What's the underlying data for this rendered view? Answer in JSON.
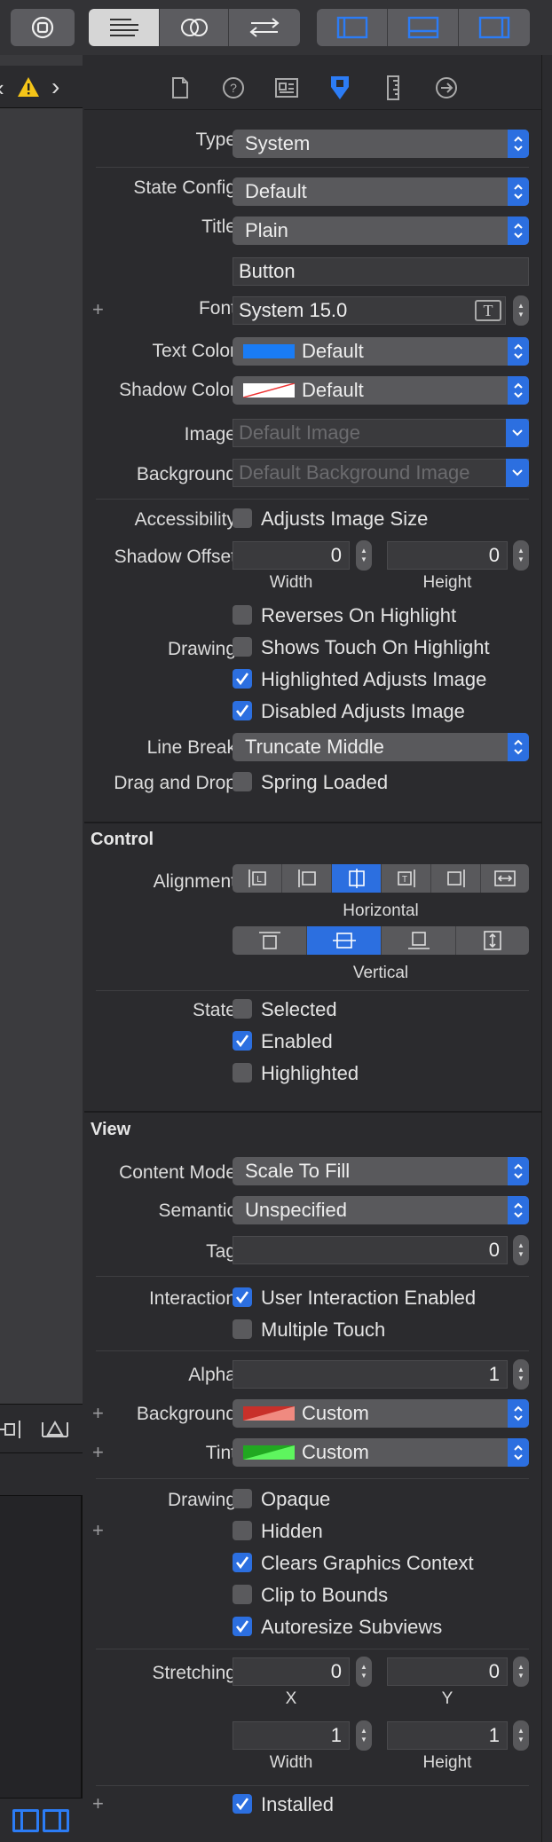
{
  "toolbar": {
    "left_icon": "stop-icon",
    "editor_modes": [
      "standard-editor-icon",
      "assistant-editor-icon",
      "version-editor-icon"
    ],
    "panel_toggles": [
      "navigator-panel-icon",
      "debug-panel-icon",
      "utilities-panel-icon"
    ]
  },
  "inspector_tabs": [
    "file-inspector-icon",
    "quick-help-icon",
    "identity-inspector-icon",
    "attributes-inspector-icon",
    "size-inspector-icon",
    "connections-inspector-icon"
  ],
  "button_section": {
    "type_label": "Type",
    "type_value": "System",
    "state_config_label": "State Config",
    "state_config_value": "Default",
    "title_label": "Title",
    "title_value": "Plain",
    "title_text": "Button",
    "font_label": "Font",
    "font_value": "System 15.0",
    "text_color_label": "Text Color",
    "text_color_value": "Default",
    "shadow_color_label": "Shadow Color",
    "shadow_color_value": "Default",
    "image_label": "Image",
    "image_placeholder": "Default Image",
    "background_label": "Background",
    "background_placeholder": "Default Background Image",
    "accessibility_label": "Accessibility",
    "adjusts_image_size": "Adjusts Image Size",
    "shadow_offset_label": "Shadow Offset",
    "shadow_width": "0",
    "shadow_height": "0",
    "width_label": "Width",
    "height_label": "Height",
    "drawing_label": "Drawing",
    "reverses_on_highlight": "Reverses On Highlight",
    "shows_touch_on_highlight": "Shows Touch On Highlight",
    "highlighted_adjusts_image": "Highlighted Adjusts Image",
    "disabled_adjusts_image": "Disabled Adjusts Image",
    "line_break_label": "Line Break",
    "line_break_value": "Truncate Middle",
    "drag_drop_label": "Drag and Drop",
    "spring_loaded": "Spring Loaded"
  },
  "control_section": {
    "title": "Control",
    "alignment_label": "Alignment",
    "horizontal_label": "Horizontal",
    "vertical_label": "Vertical",
    "state_label": "State",
    "selected": "Selected",
    "enabled": "Enabled",
    "highlighted": "Highlighted"
  },
  "view_section": {
    "title": "View",
    "content_mode_label": "Content Mode",
    "content_mode_value": "Scale To Fill",
    "semantic_label": "Semantic",
    "semantic_value": "Unspecified",
    "tag_label": "Tag",
    "tag_value": "0",
    "interaction_label": "Interaction",
    "user_interaction_enabled": "User Interaction Enabled",
    "multiple_touch": "Multiple Touch",
    "alpha_label": "Alpha",
    "alpha_value": "1",
    "background_label": "Background",
    "background_value": "Custom",
    "tint_label": "Tint",
    "tint_value": "Custom",
    "drawing_label": "Drawing",
    "opaque": "Opaque",
    "hidden": "Hidden",
    "clears_graphics_context": "Clears Graphics Context",
    "clip_to_bounds": "Clip to Bounds",
    "autoresize_subviews": "Autoresize Subviews",
    "stretching_label": "Stretching",
    "stretch_x": "0",
    "stretch_y": "0",
    "stretch_width": "1",
    "stretch_height": "1",
    "x_label": "X",
    "y_label": "Y",
    "width_label": "Width",
    "height_label": "Height",
    "installed": "Installed"
  },
  "colors": {
    "accent": "#2c6fe0",
    "text_color_swatch": "#1a7cf5",
    "background_swatch": "#c8302a",
    "tint_swatch": "#2fcf2f",
    "warning": "#f5c518"
  }
}
